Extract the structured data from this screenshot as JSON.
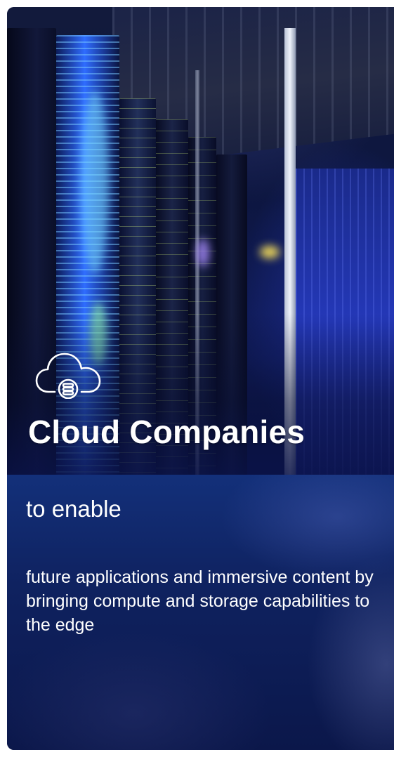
{
  "card": {
    "image": "server-room-photo",
    "icon": "cloud-database-icon",
    "title": "Cloud Companies",
    "subtitle": "to enable",
    "description": "future applications and immersive content by bringing compute and storage capabilities to the edge"
  },
  "colors": {
    "panel": "#0b154a",
    "panel_light": "#13307a",
    "text": "#ffffff"
  }
}
